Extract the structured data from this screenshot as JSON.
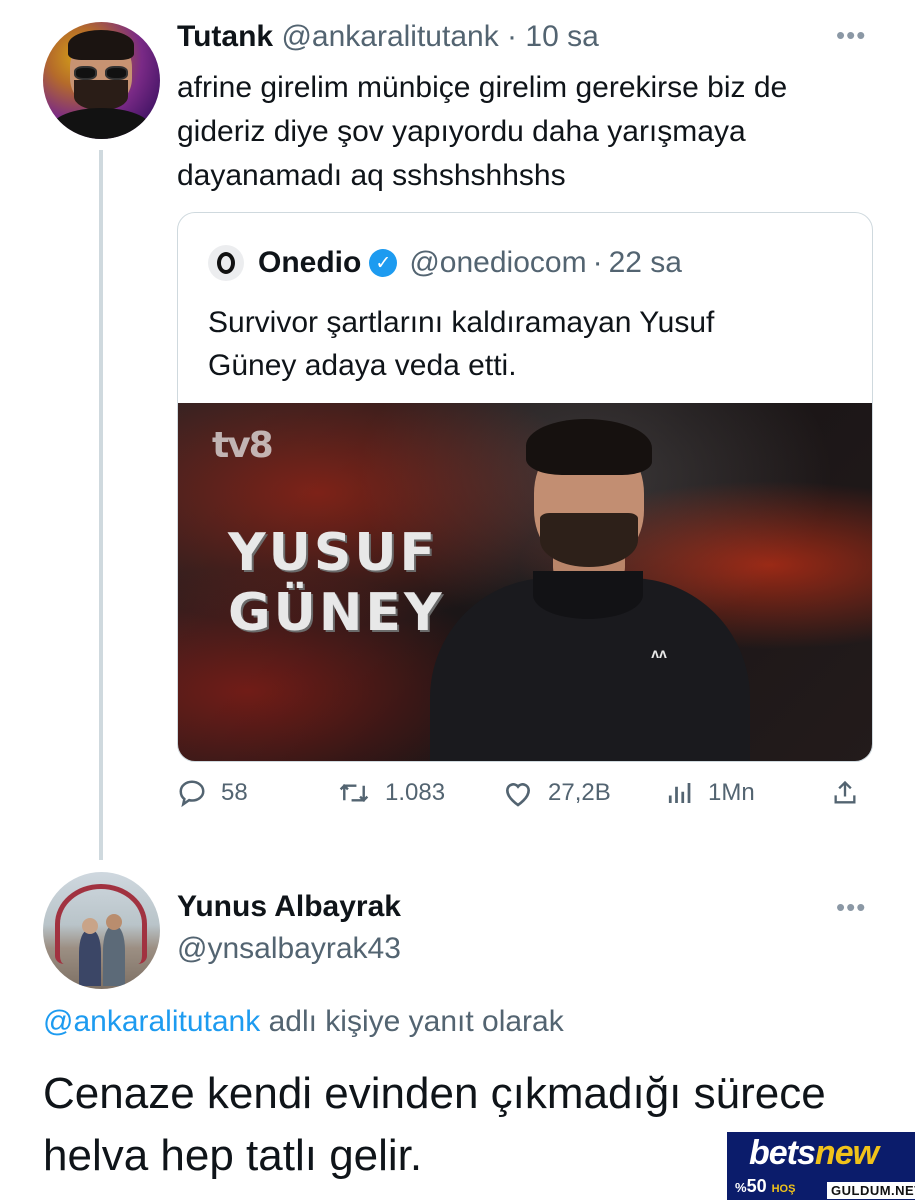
{
  "tweet1": {
    "display_name": "Tutank",
    "handle": "@ankaralitutank",
    "separator": "·",
    "time": "10 sa",
    "more": "•••",
    "text_lines": [
      "afrine girelim münbiçe girelim gerekirse biz de",
      "gideriz  diye şov yapıyordu daha yarışmaya",
      "dayanamadı aq sshshshhshs"
    ]
  },
  "quoted": {
    "display_name": "Onedio",
    "handle": "@onediocom",
    "separator": "·",
    "time": "22 sa",
    "text_lines": [
      "Survivor şartlarını kaldıramayan Yusuf",
      "Güney adaya veda etti."
    ],
    "media": {
      "channel_logo": "tv8",
      "title_lines": [
        "YUSUF",
        "GÜNEY"
      ],
      "shirt_logo": "ᴧᴧ"
    }
  },
  "actions": {
    "replies": "58",
    "retweets": "1.083",
    "likes": "27,2B",
    "views": "1Mn",
    "icons": [
      "reply-icon",
      "retweet-icon",
      "like-icon",
      "views-icon",
      "share-icon"
    ]
  },
  "tweet2": {
    "display_name": "Yunus Albayrak",
    "handle": "@ynsalbayrak43",
    "more": "•••",
    "reply_to_handle": "@ankaralitutank",
    "reply_to_suffix": " adlı kişiye yanıt olarak",
    "text_lines": [
      "Cenaze kendi evinden çıkmadığı sürece",
      "helva hep tatlı gelir."
    ]
  },
  "watermark": {
    "brand_a": "bets",
    "brand_b": "new",
    "pct": "%",
    "bonus": "50",
    "promo": "HOŞ",
    "site": "GULDUM.NET"
  },
  "colors": {
    "link": "#1d9bf0",
    "muted": "#536471",
    "text": "#0f1419",
    "border": "#cfd9de"
  }
}
